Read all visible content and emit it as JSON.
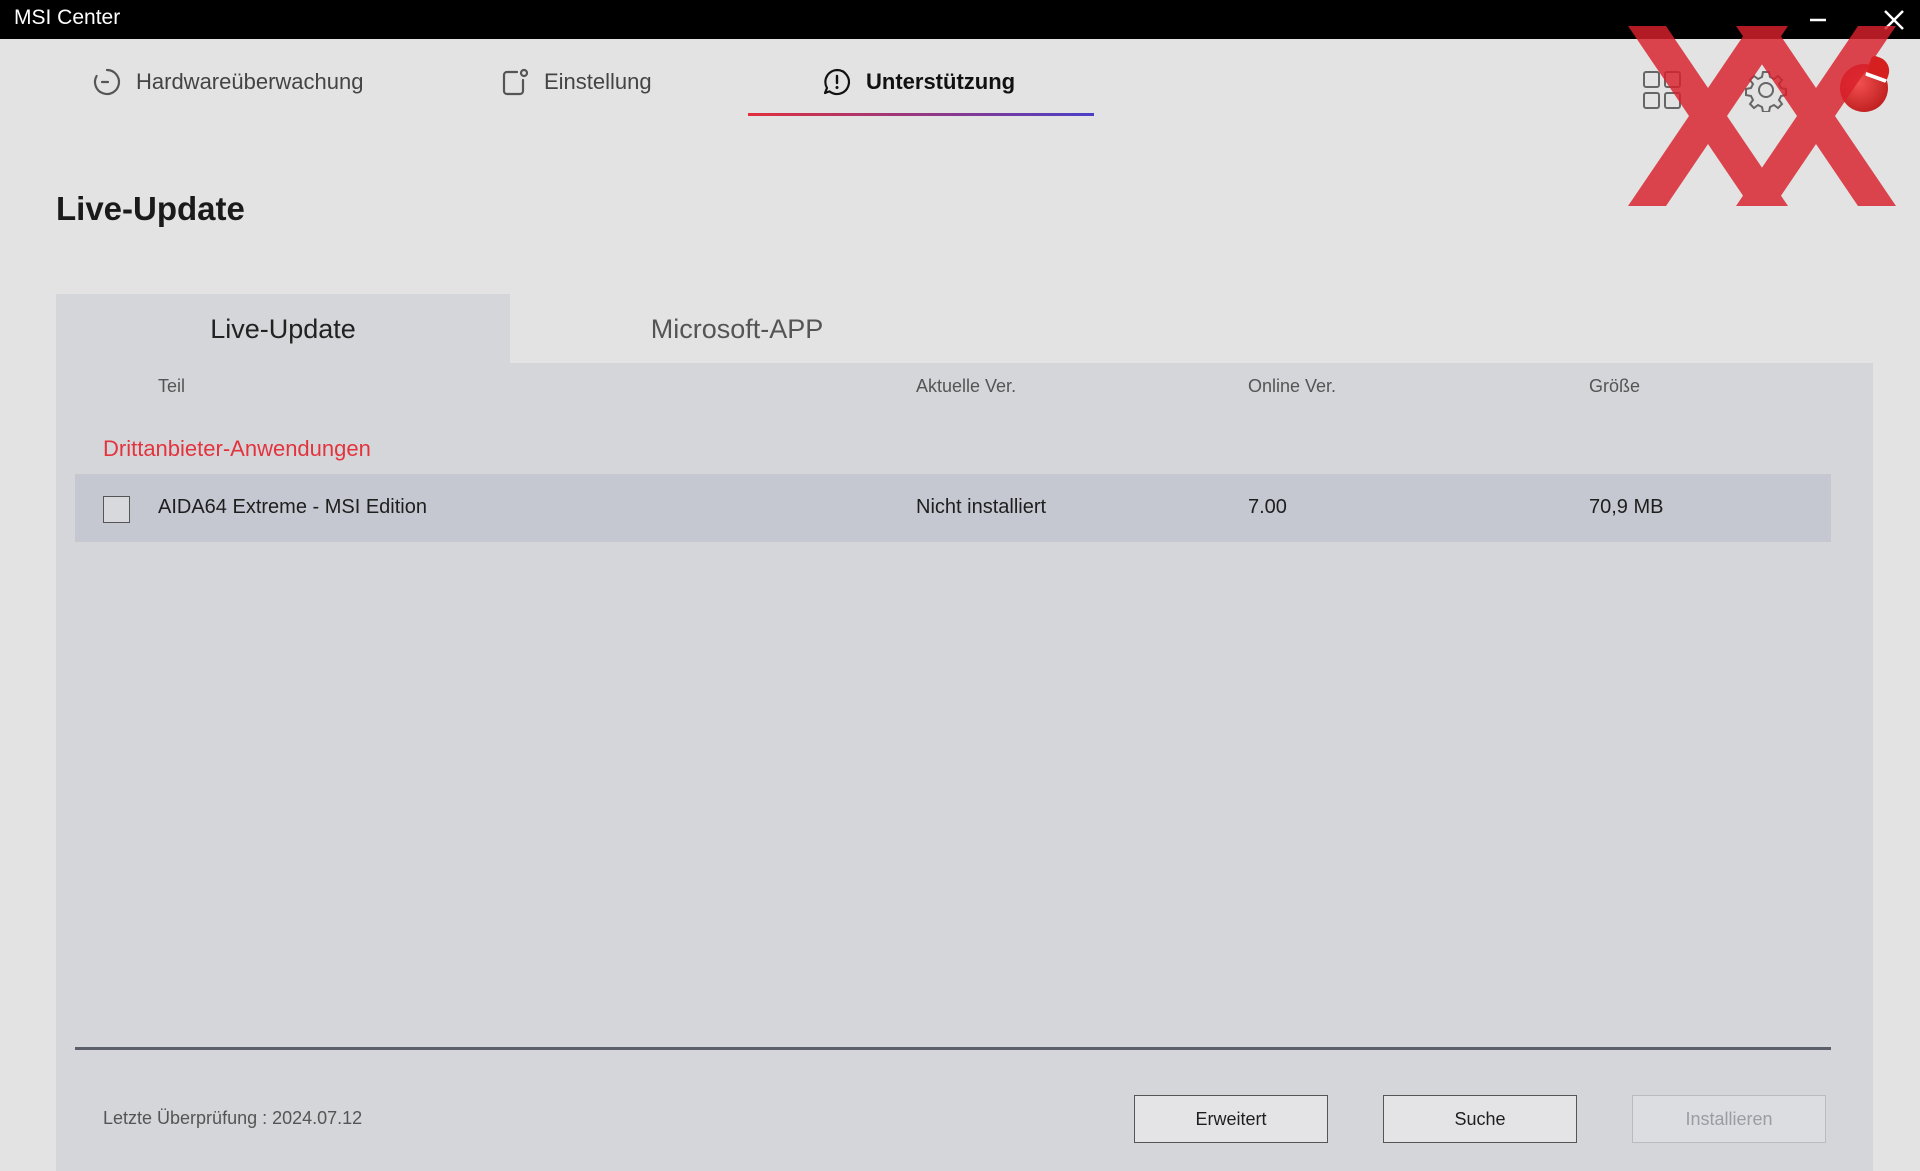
{
  "window": {
    "title": "MSI Center",
    "minimize_icon": "minimize-icon",
    "close_icon": "close-icon"
  },
  "nav": {
    "items": [
      {
        "label": "Hardwareüberwachung",
        "icon": "clock-icon"
      },
      {
        "label": "Einstellung",
        "icon": "settings-square-icon"
      },
      {
        "label": "Unterstützung",
        "icon": "alert-bubble-icon",
        "active": true
      }
    ],
    "active_gradient": [
      "#e0303c",
      "#4b3fc8"
    ],
    "right_icons": [
      "apps-grid-icon",
      "gear-icon",
      "avatar"
    ]
  },
  "page": {
    "title": "Live-Update"
  },
  "tabs": [
    {
      "label": "Live-Update",
      "active": true
    },
    {
      "label": "Microsoft-APP",
      "active": false
    }
  ],
  "table": {
    "headers": {
      "part": "Teil",
      "current": "Aktuelle Ver.",
      "online": "Online Ver.",
      "size": "Größe"
    },
    "group": {
      "label": "Drittanbieter-Anwendungen",
      "color": "#e3343e"
    },
    "rows": [
      {
        "checked": false,
        "name": "AIDA64 Extreme - MSI Edition",
        "current": "Nicht installiert",
        "online": "7.00",
        "size": "70,9 MB"
      }
    ]
  },
  "footer": {
    "last_check": "Letzte Überprüfung : 2024.07.12",
    "buttons": {
      "advanced": "Erweitert",
      "search": "Suche",
      "install": "Installieren"
    },
    "install_disabled": true
  },
  "watermark": {
    "description": "red XX logo",
    "color": "#d9202c"
  }
}
